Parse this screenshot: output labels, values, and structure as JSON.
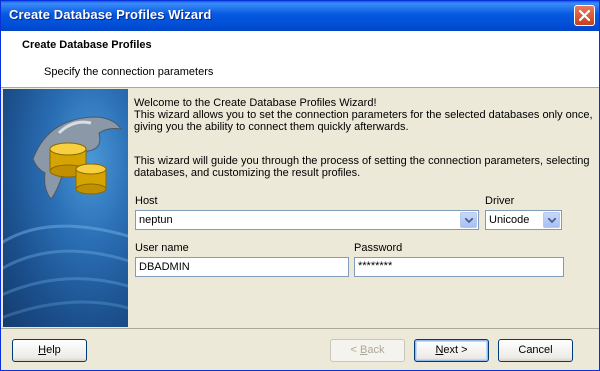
{
  "window": {
    "title": "Create Database Profiles Wizard"
  },
  "header": {
    "title": "Create Database Profiles",
    "subtitle": "Specify the connection parameters"
  },
  "intro": {
    "line1": "Welcome to the Create Database Profiles Wizard!",
    "line2": "This wizard allows you to set the connection parameters for the selected databases only once,",
    "line3": "giving you the ability to connect them quickly afterwards.",
    "line4": "This wizard will guide you through the process of setting the connection parameters, selecting",
    "line5": "databases, and customizing the result profiles."
  },
  "form": {
    "host_label": "Host",
    "host_value": "neptun",
    "driver_label": "Driver",
    "driver_value": "Unicode",
    "username_label": "User name",
    "username_value": "DBADMIN",
    "password_label": "Password",
    "password_value": "********"
  },
  "buttons": {
    "help_first": "H",
    "help_rest": "elp",
    "back_pre": "< ",
    "back_u": "B",
    "back_rest": "ack",
    "next_u": "N",
    "next_rest": "ext >",
    "cancel": "Cancel"
  }
}
